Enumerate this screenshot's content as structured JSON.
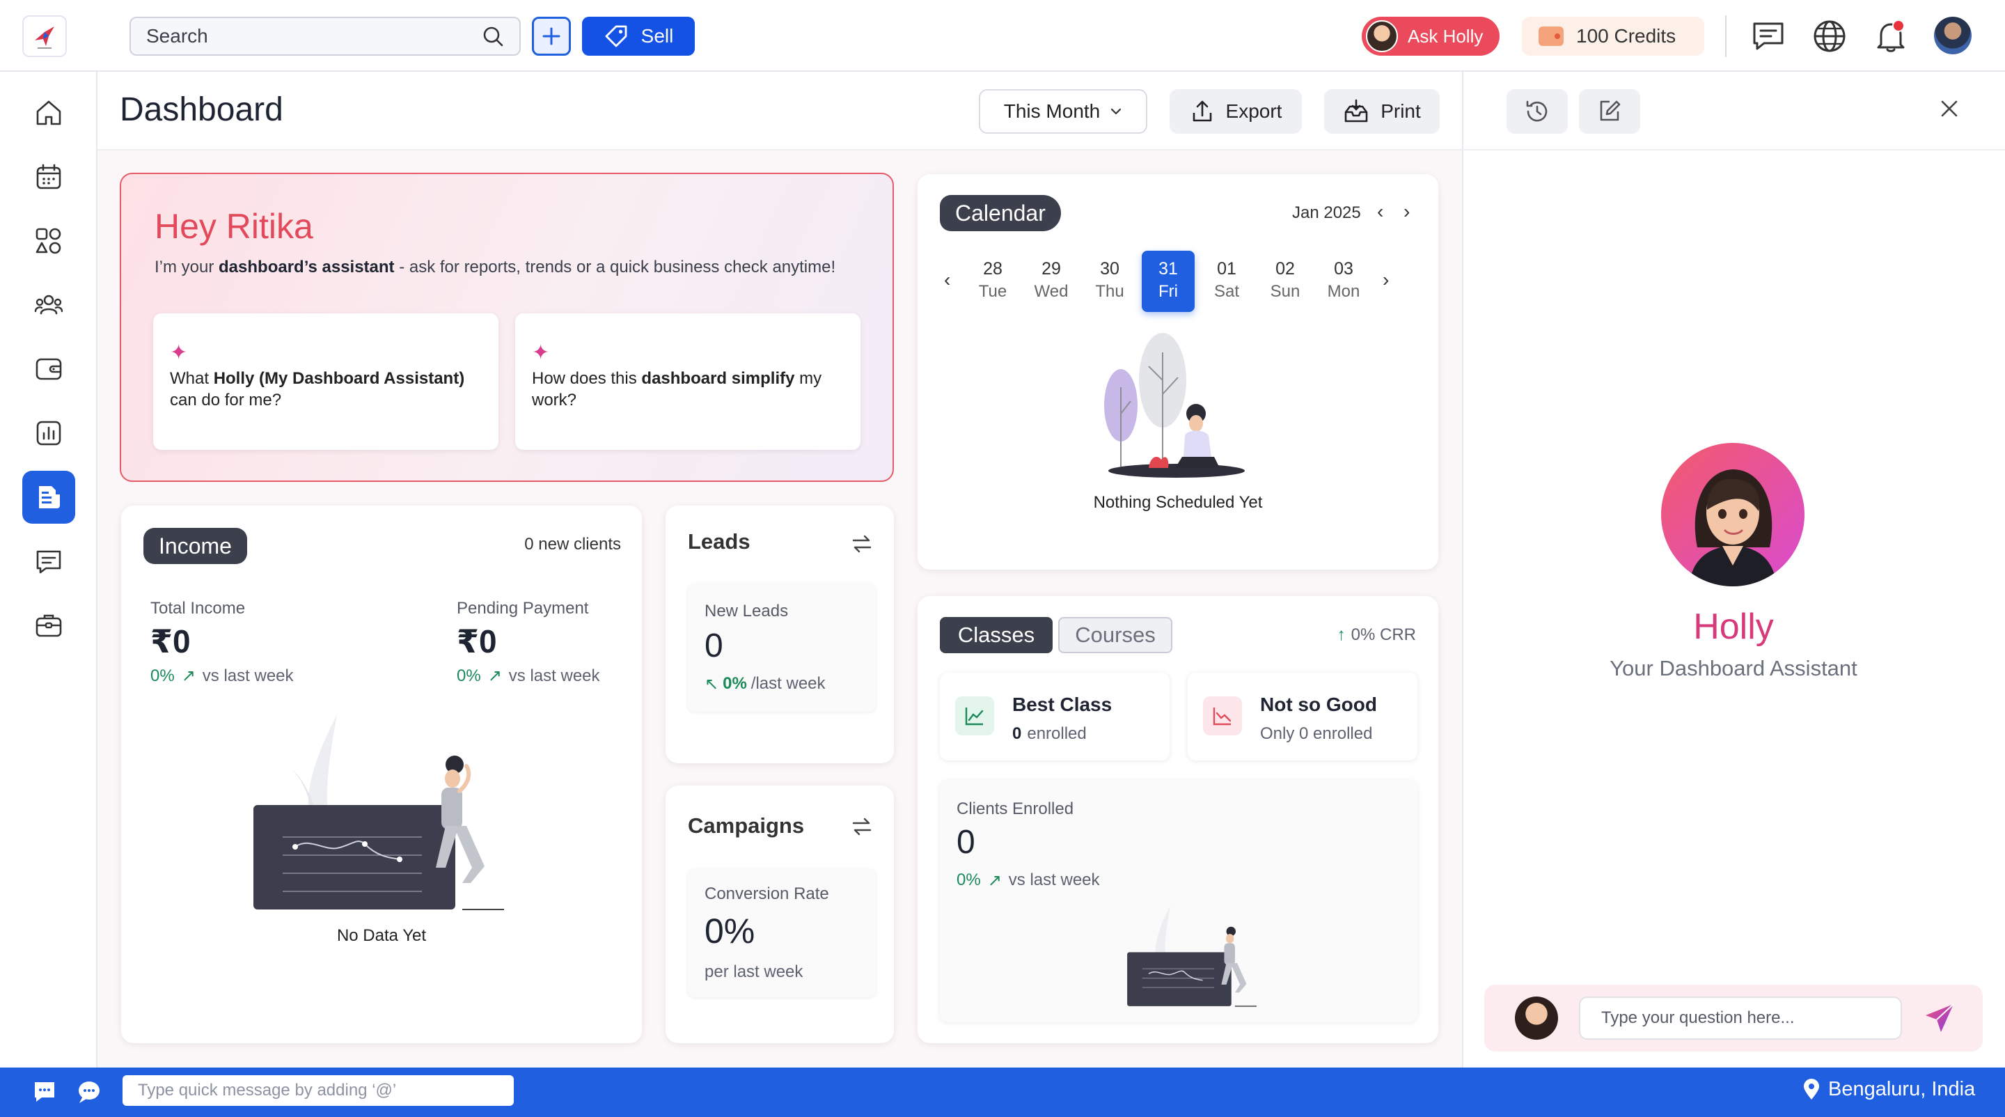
{
  "topbar": {
    "search_placeholder": "Search",
    "sell_label": "Sell",
    "ask_holly_label": "Ask Holly",
    "credits_label": "100 Credits"
  },
  "header": {
    "title": "Dashboard",
    "period_label": "This Month",
    "export_label": "Export",
    "print_label": "Print"
  },
  "hero": {
    "greeting": "Hey Ritika",
    "subtitle_pre": "I’m your ",
    "subtitle_bold": "dashboard’s assistant",
    "subtitle_post": " - ask for reports, trends or a quick business check anytime!",
    "prompts": [
      {
        "pre": "What ",
        "bold": "Holly (My Dashboard Assistant)",
        "post": " can do for me?"
      },
      {
        "pre": "How does this ",
        "bold": "dashboard simplify",
        "post": " my work?"
      }
    ]
  },
  "income": {
    "title": "Income",
    "new_clients": "0 new clients",
    "total_label": "Total Income",
    "total_value": "₹0",
    "total_change": "0%",
    "total_change_suffix": "vs last week",
    "pending_label": "Pending Payment",
    "pending_value": "₹0",
    "pending_change": "0%",
    "pending_change_suffix": "vs last week",
    "empty_text": "No Data Yet"
  },
  "leads": {
    "title": "Leads",
    "metric_label": "New Leads",
    "metric_value": "0",
    "change": "0%",
    "change_suffix": "/last week"
  },
  "campaigns": {
    "title": "Campaigns",
    "metric_label": "Conversion Rate",
    "metric_value": "0%",
    "metric_suffix": "per last week"
  },
  "calendar": {
    "title": "Calendar",
    "month_label": "Jan 2025",
    "days": [
      {
        "num": "28",
        "name": "Tue",
        "selected": false
      },
      {
        "num": "29",
        "name": "Wed",
        "selected": false
      },
      {
        "num": "30",
        "name": "Thu",
        "selected": false
      },
      {
        "num": "31",
        "name": "Fri",
        "selected": true
      },
      {
        "num": "01",
        "name": "Sat",
        "selected": false
      },
      {
        "num": "02",
        "name": "Sun",
        "selected": false
      },
      {
        "num": "03",
        "name": "Mon",
        "selected": false
      }
    ],
    "empty_text": "Nothing Scheduled Yet"
  },
  "classes": {
    "tab_classes": "Classes",
    "tab_courses": "Courses",
    "crr": "0% CRR",
    "best_title": "Best Class",
    "best_count": "0",
    "best_suffix": "enrolled",
    "worst_title": "Not so Good",
    "worst_text": "Only 0 enrolled",
    "clients_label": "Clients Enrolled",
    "clients_value": "0",
    "clients_change": "0%",
    "clients_suffix": "vs last week"
  },
  "panel": {
    "name": "Holly",
    "subtitle": "Your Dashboard Assistant",
    "chat_placeholder": "Type your question here..."
  },
  "bottombar": {
    "quick_placeholder": "Type quick message by adding ‘@’",
    "location": "Bengaluru, India"
  },
  "colors": {
    "brand_blue": "#1f5fe0",
    "accent_red": "#e24a5c",
    "holly_pink": "#d63a7a",
    "positive_green": "#1b8a59",
    "dark_badge": "#3c3f4c"
  },
  "icons": {
    "sidebar": [
      "home-icon",
      "calendar-icon",
      "apps-icon",
      "users-icon",
      "wallet-icon",
      "analytics-icon",
      "reports-icon",
      "messages-icon",
      "briefcase-icon"
    ],
    "topbar": [
      "search-icon",
      "plus-icon",
      "tag-icon",
      "chat-icon",
      "globe-icon",
      "bell-icon"
    ]
  }
}
